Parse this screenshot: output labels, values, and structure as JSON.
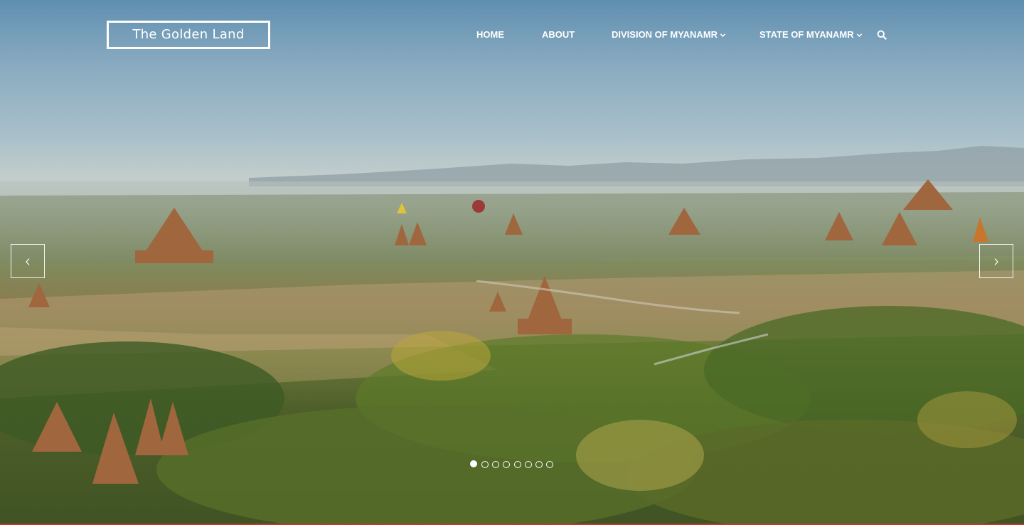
{
  "header": {
    "logo_text": "The Golden Land"
  },
  "nav": {
    "items": [
      {
        "label": "HOME",
        "has_dropdown": false
      },
      {
        "label": "ABOUT",
        "has_dropdown": false
      },
      {
        "label": "DIVISION OF MYANAMR",
        "has_dropdown": true
      },
      {
        "label": "STATE OF MYANAMR",
        "has_dropdown": true
      }
    ],
    "search_icon": "search-icon",
    "dropdown_icon": "chevron-down-icon"
  },
  "slider": {
    "prev_icon": "chevron-left-icon",
    "next_icon": "chevron-right-icon",
    "slide_count": 8,
    "active_slide": 1
  },
  "colors": {
    "text": "#ffffff",
    "bottom_border": "#c0392b"
  }
}
